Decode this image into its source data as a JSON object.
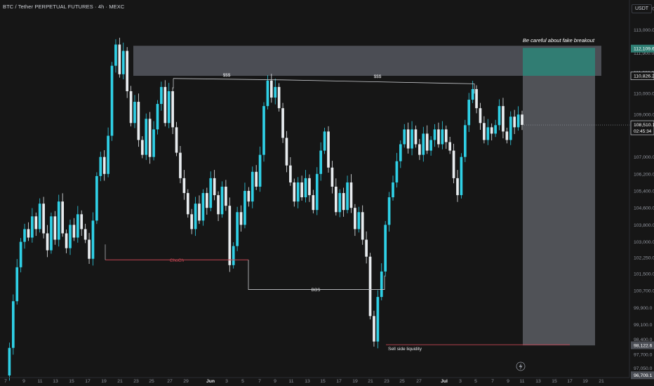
{
  "header": {
    "title": "BTC / Tether PERPETUAL FUTURES · 4h · MEXC",
    "currency": "USDT"
  },
  "colors": {
    "background": "#161616",
    "up_candle": "#2fd0e6",
    "down_candle": "#e8ecef",
    "zone": "#5b5e66",
    "target_box": "#2f7f74",
    "choch_line": "#c64552",
    "bos_line": "#c8cace",
    "liquidity_line": "#c64552",
    "axis_text": "#8f939c"
  },
  "chart_data": {
    "type": "candlestick",
    "price_axis_ticks": [
      "114,000.0",
      "113,000.0",
      "111,900.0",
      "111,000.0",
      "110,000.0",
      "109,000.0",
      "107,000.0",
      "106,200.0",
      "105,400.0",
      "104,600.0",
      "103,800.0",
      "103,000.0",
      "102,250.0",
      "101,500.0",
      "100,700.0",
      "99,900.0",
      "99,100.0",
      "98,400.0",
      "97,700.0",
      "97,050.0"
    ],
    "price_labels": {
      "target": "112,109.6",
      "zone_level": "110,826.2",
      "current_price": "108,510.1",
      "countdown": "02:45:34",
      "low_marker": "98,122.6",
      "bottom": "96,709.1"
    },
    "time_axis_ticks": [
      "7",
      "9",
      "11",
      "13",
      "15",
      "17",
      "19",
      "21",
      "23",
      "25",
      "27",
      "29",
      "Jun",
      "3",
      "5",
      "7",
      "9",
      "11",
      "13",
      "15",
      "17",
      "19",
      "21",
      "23",
      "25",
      "27",
      "Jul",
      "3",
      "5",
      "7",
      "9",
      "11",
      "13",
      "15",
      "17",
      "19",
      "21"
    ],
    "ylim": [
      96600,
      114400
    ],
    "ohlc_path": [
      [
        0,
        96700
      ],
      [
        1,
        98000
      ],
      [
        2,
        100200
      ],
      [
        3,
        101800
      ],
      [
        4,
        103000
      ],
      [
        5,
        103600
      ],
      [
        6,
        103200
      ],
      [
        7,
        104200
      ],
      [
        8,
        103600
      ],
      [
        9,
        104800
      ],
      [
        10,
        103400
      ],
      [
        11,
        102600
      ],
      [
        12,
        104200
      ],
      [
        13,
        103100
      ],
      [
        14,
        104900
      ],
      [
        15,
        103400
      ],
      [
        16,
        102700
      ],
      [
        17,
        103800
      ],
      [
        18,
        103200
      ],
      [
        19,
        104300
      ],
      [
        20,
        103600
      ],
      [
        21,
        103100
      ],
      [
        22,
        102200
      ],
      [
        23,
        104000
      ],
      [
        24,
        106100
      ],
      [
        25,
        107000
      ],
      [
        26,
        106200
      ],
      [
        27,
        108000
      ],
      [
        28,
        111300
      ],
      [
        29,
        112300
      ],
      [
        30,
        110900
      ],
      [
        31,
        112000
      ],
      [
        32,
        110100
      ],
      [
        33,
        108600
      ],
      [
        34,
        109600
      ],
      [
        35,
        107800
      ],
      [
        36,
        107100
      ],
      [
        37,
        108800
      ],
      [
        38,
        107000
      ],
      [
        39,
        108300
      ],
      [
        40,
        109500
      ],
      [
        41,
        110300
      ],
      [
        42,
        108600
      ],
      [
        43,
        110100
      ],
      [
        44,
        108400
      ],
      [
        45,
        107200
      ],
      [
        46,
        106000
      ],
      [
        47,
        105300
      ],
      [
        48,
        104300
      ],
      [
        49,
        103600
      ],
      [
        50,
        104800
      ],
      [
        51,
        104000
      ],
      [
        52,
        105300
      ],
      [
        53,
        104600
      ],
      [
        54,
        106000
      ],
      [
        55,
        105200
      ],
      [
        56,
        104300
      ],
      [
        57,
        105600
      ],
      [
        58,
        104700
      ],
      [
        59,
        101900
      ],
      [
        60,
        102800
      ],
      [
        61,
        104400
      ],
      [
        62,
        103800
      ],
      [
        63,
        105400
      ],
      [
        64,
        104900
      ],
      [
        65,
        106300
      ],
      [
        66,
        105600
      ],
      [
        67,
        107100
      ],
      [
        68,
        109400
      ],
      [
        69,
        110600
      ],
      [
        70,
        109800
      ],
      [
        71,
        110300
      ],
      [
        72,
        109300
      ],
      [
        73,
        107900
      ],
      [
        74,
        106600
      ],
      [
        75,
        105800
      ],
      [
        76,
        104900
      ],
      [
        77,
        105800
      ],
      [
        78,
        105100
      ],
      [
        79,
        106000
      ],
      [
        80,
        105200
      ],
      [
        81,
        104500
      ],
      [
        82,
        106200
      ],
      [
        83,
        107300
      ],
      [
        84,
        108200
      ],
      [
        85,
        106500
      ],
      [
        86,
        105600
      ],
      [
        87,
        104400
      ],
      [
        88,
        105300
      ],
      [
        89,
        104500
      ],
      [
        90,
        105800
      ],
      [
        91,
        104600
      ],
      [
        92,
        103600
      ],
      [
        93,
        104400
      ],
      [
        94,
        103100
      ],
      [
        95,
        102300
      ],
      [
        96,
        99500
      ],
      [
        97,
        98300
      ],
      [
        98,
        100400
      ],
      [
        99,
        101600
      ],
      [
        100,
        103800
      ],
      [
        101,
        105100
      ],
      [
        102,
        105800
      ],
      [
        103,
        106800
      ],
      [
        104,
        107600
      ],
      [
        105,
        108300
      ],
      [
        106,
        107400
      ],
      [
        107,
        108300
      ],
      [
        108,
        107600
      ],
      [
        109,
        107100
      ],
      [
        110,
        108100
      ],
      [
        111,
        107300
      ],
      [
        112,
        107800
      ],
      [
        113,
        108300
      ],
      [
        114,
        107600
      ],
      [
        115,
        108300
      ],
      [
        116,
        107700
      ],
      [
        117,
        107300
      ],
      [
        118,
        106000
      ],
      [
        119,
        105200
      ],
      [
        120,
        107000
      ],
      [
        121,
        108500
      ],
      [
        122,
        109700
      ],
      [
        123,
        110200
      ],
      [
        124,
        109300
      ],
      [
        125,
        108600
      ],
      [
        126,
        107800
      ],
      [
        127,
        108400
      ],
      [
        128,
        108100
      ],
      [
        129,
        108500
      ],
      [
        130,
        109400
      ],
      [
        131,
        108200
      ],
      [
        132,
        107800
      ],
      [
        133,
        108900
      ],
      [
        134,
        108400
      ],
      [
        135,
        109000
      ],
      [
        136,
        108510
      ]
    ],
    "annotations": {
      "zone_note": "Be careful about fake breakout",
      "choch": "ChoCh",
      "bos": "BOS",
      "liquidity_top_1": "$$$",
      "liquidity_top_2": "$$$",
      "sell_side": "Sell side liquidity"
    },
    "levels": {
      "supply_zone": [
        110826,
        112109
      ],
      "choch_level": 102150,
      "bos_level": 100750,
      "sell_side_level": 98150,
      "equal_highs_left": 110700,
      "equal_highs_right": 110450
    }
  }
}
